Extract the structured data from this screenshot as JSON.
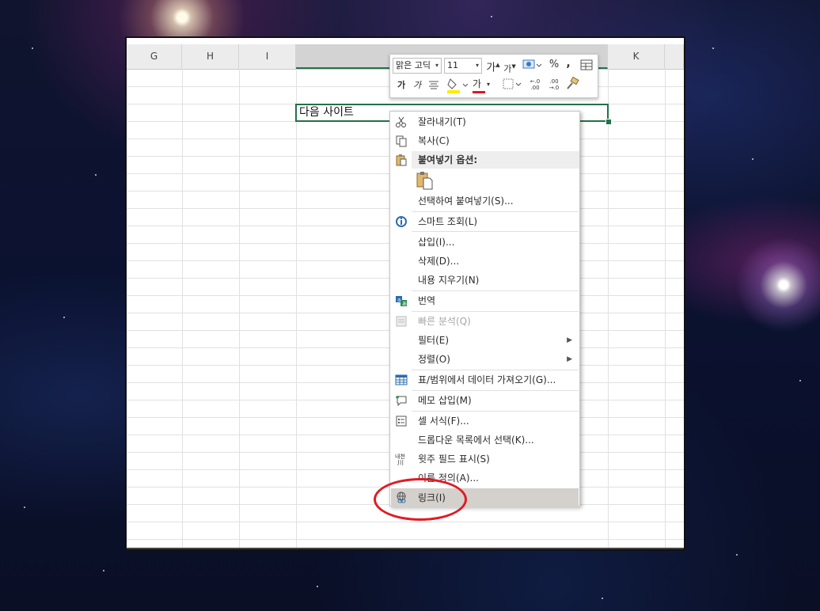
{
  "spreadsheet": {
    "columns": [
      {
        "label": "G"
      },
      {
        "label": "H"
      },
      {
        "label": "I"
      },
      {
        "label": ""
      },
      {
        "label": "K"
      }
    ],
    "active_cell_text": "다음 사이트"
  },
  "mini_toolbar": {
    "font_name": "맑은 고딕",
    "font_size": "11",
    "increase_font": "가",
    "decrease_font": "가",
    "percent": "%",
    "comma": ",",
    "bold": "가",
    "italic": "가",
    "font_color_letter": "가",
    "increase_decimal": "←.0 .00",
    "decrease_decimal": ".00 →.0",
    "font_color_hex": "#e81123",
    "highlight_hex": "#ffeb00"
  },
  "context_menu": {
    "items": [
      {
        "label": "잘라내기(T)",
        "icon": "scissors-icon"
      },
      {
        "label": "복사(C)",
        "icon": "copy-icon"
      },
      {
        "label": "붙여넣기 옵션:",
        "icon": "paste-icon"
      },
      {
        "label": "선택하여 붙여넣기(S)...",
        "icon": ""
      },
      {
        "label": "스마트 조회(L)",
        "icon": "smart-lookup-icon"
      },
      {
        "label": "삽입(I)...",
        "icon": ""
      },
      {
        "label": "삭제(D)...",
        "icon": ""
      },
      {
        "label": "내용 지우기(N)",
        "icon": ""
      },
      {
        "label": "번역",
        "icon": "translate-icon"
      },
      {
        "label": "빠른 분석(Q)",
        "icon": "quick-analysis-icon"
      },
      {
        "label": "필터(E)",
        "icon": ""
      },
      {
        "label": "정렬(O)",
        "icon": ""
      },
      {
        "label": "표/범위에서 데이터 가져오기(G)...",
        "icon": "table-icon"
      },
      {
        "label": "메모 삽입(M)",
        "icon": "comment-icon"
      },
      {
        "label": "셀 서식(F)...",
        "icon": "format-cells-icon"
      },
      {
        "label": "드롭다운 목록에서 선택(K)...",
        "icon": ""
      },
      {
        "label": "윗주 필드 표시(S)",
        "icon": "phonetic-icon"
      },
      {
        "label": "이름 정의(A)...",
        "icon": ""
      },
      {
        "label": "링크(I)",
        "icon": "link-icon"
      }
    ]
  },
  "colors": {
    "excel_green": "#217346",
    "annotation_red": "#e01b24",
    "menu_hover": "#d4d0cc"
  }
}
